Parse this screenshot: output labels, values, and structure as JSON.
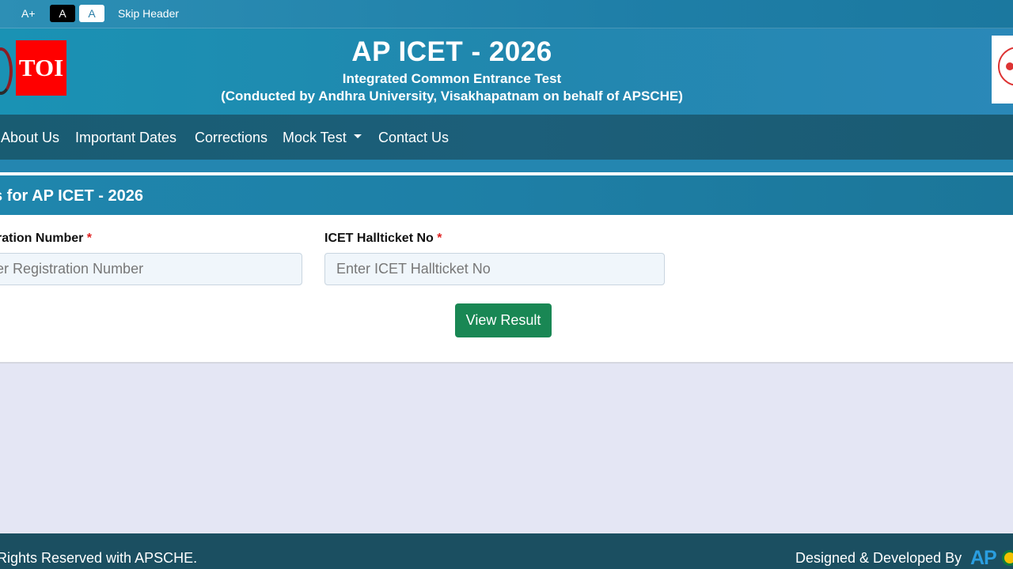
{
  "access_bar": {
    "font_increase": "A+",
    "contrast_dark": "A",
    "contrast_light": "A",
    "skip_header": "Skip Header"
  },
  "header": {
    "logo_text": "TOI",
    "title": "AP ICET - 2026",
    "subtitle": "Integrated Common Entrance Test",
    "subtitle2": "(Conducted by Andhra University, Visakhapatnam on behalf of APSCHE)"
  },
  "nav": {
    "items": [
      {
        "label": "About Us"
      },
      {
        "label": "Important Dates"
      },
      {
        "label": "Corrections"
      },
      {
        "label": "Mock Test",
        "has_dropdown": true
      },
      {
        "label": "Contact Us"
      }
    ]
  },
  "card": {
    "title": "s for AP ICET - 2026",
    "fields": [
      {
        "label": "ration Number",
        "required_mark": "*",
        "placeholder": "er Registration Number",
        "value": ""
      },
      {
        "label": "ICET Hallticket No",
        "required_mark": "*",
        "placeholder": "Enter ICET Hallticket No",
        "value": ""
      }
    ],
    "submit_label": "View Result"
  },
  "footer": {
    "rights": "Rights Reserved with APSCHE.",
    "designed_by": "Designed & Developed By",
    "logo_text": "AP"
  },
  "colors": {
    "header_blue": "#2187ae",
    "nav_dark": "#1c5f7a",
    "button_green": "#198754",
    "page_bg": "#e4e6f4",
    "footer_bg": "#1b4f61"
  }
}
